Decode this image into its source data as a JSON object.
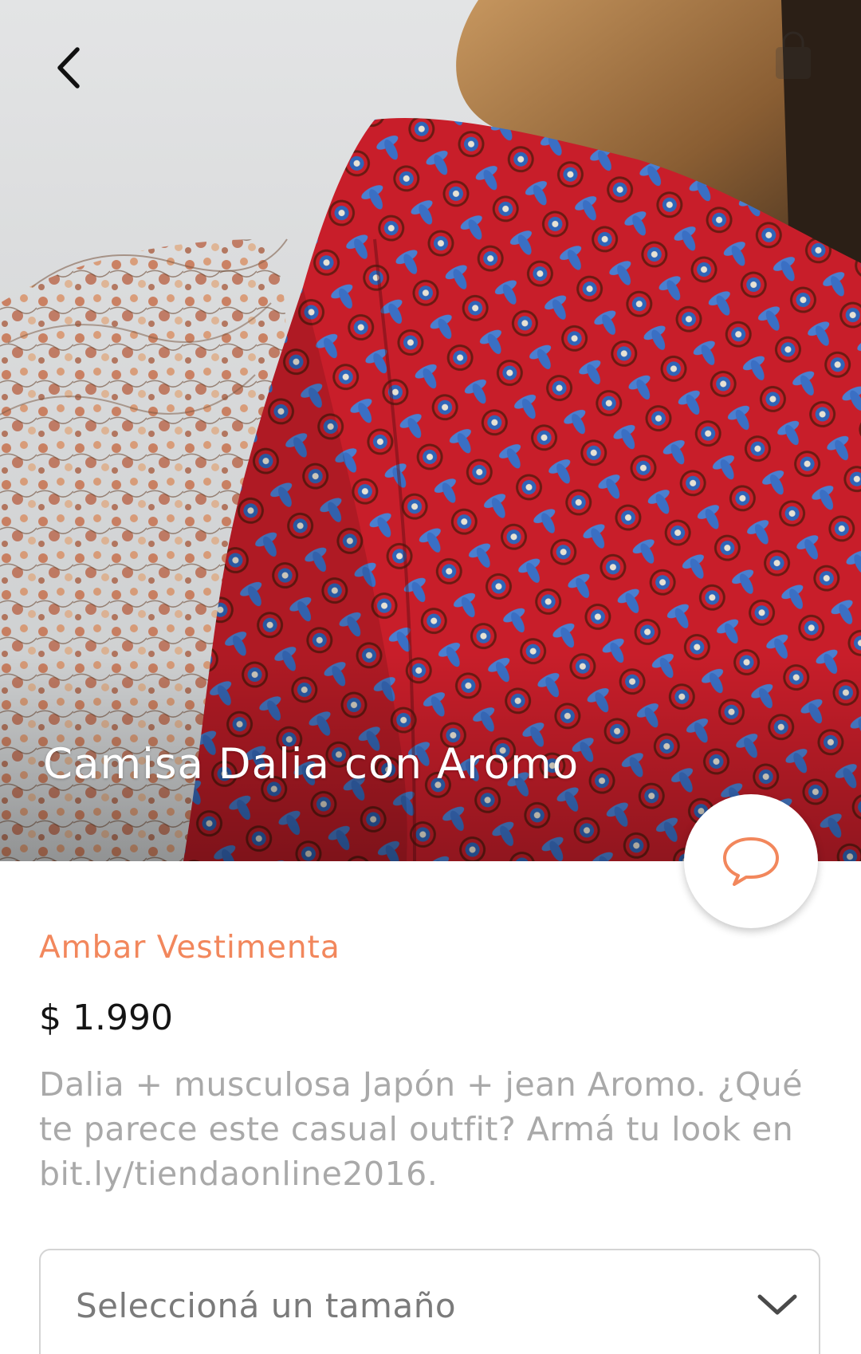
{
  "product": {
    "title": "Camisa Dalia con Aromo",
    "brand": "Ambar Vestimenta",
    "price": "$ 1.990",
    "description": "Dalia + musculosa Japón + jean Aromo. ¿Qué te parece este casual outfit? Armá tu look en bit.ly/tiendaonline2016."
  },
  "size_selector": {
    "placeholder": "Seleccioná un tamaño"
  },
  "icons": {
    "back": "chevron-left-icon",
    "cart": "shopping-bag-icon",
    "chat": "speech-bubble-icon",
    "dropdown": "chevron-down-icon"
  },
  "colors": {
    "accent": "#f2875c",
    "price_text": "#141414",
    "description_text": "#a9a9a9",
    "shirt_red": "#c81e2a",
    "shirt_pattern_blue": "#3a6fc4"
  }
}
